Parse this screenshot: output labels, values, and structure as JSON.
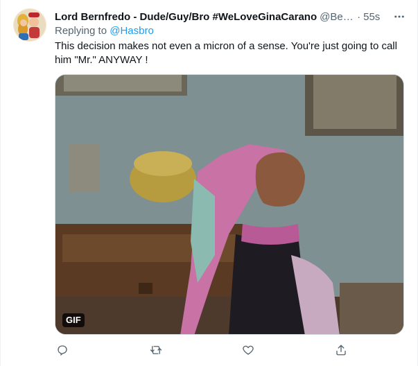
{
  "tweet": {
    "display_name": "Lord Bernfredo - Dude/Guy/Bro #WeLoveGinaCarano",
    "handle": "@Bernfredo",
    "separator": "·",
    "timestamp": "55s",
    "replying_prefix": "Replying to ",
    "replying_to": "@Hasbro",
    "text": "This decision makes not even a micron of a sense. You're just going to call him \"Mr.\" ANYWAY !",
    "media": {
      "badge": "GIF"
    }
  },
  "icons": {
    "more": "more-dots-icon",
    "reply": "reply-icon",
    "retweet": "retweet-icon",
    "like": "heart-icon",
    "share": "share-icon"
  },
  "colors": {
    "accent": "#1d9bf0",
    "secondary_text": "#536471",
    "primary_text": "#0f1419"
  }
}
